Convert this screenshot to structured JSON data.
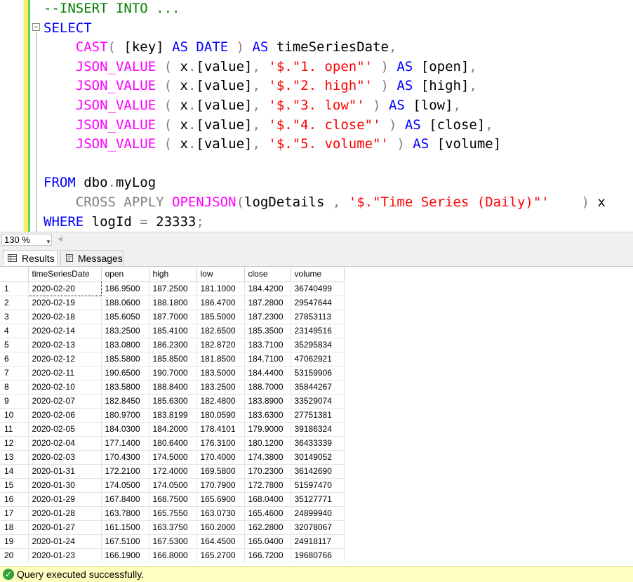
{
  "editor": {
    "lines": [
      [
        {
          "t": "--INSERT INTO ...",
          "c": "cm"
        }
      ],
      [
        {
          "t": "SELECT",
          "c": "kw"
        }
      ],
      [
        {
          "t": "    ",
          "c": "tx"
        },
        {
          "t": "CAST",
          "c": "fn"
        },
        {
          "t": "( ",
          "c": "op"
        },
        {
          "t": "[key] ",
          "c": "tx"
        },
        {
          "t": "AS ",
          "c": "kw"
        },
        {
          "t": "DATE ",
          "c": "kw"
        },
        {
          "t": ") ",
          "c": "op"
        },
        {
          "t": "AS ",
          "c": "kw"
        },
        {
          "t": "timeSeriesDate",
          "c": "tx"
        },
        {
          "t": ",",
          "c": "op"
        }
      ],
      [
        {
          "t": "    ",
          "c": "tx"
        },
        {
          "t": "JSON_VALUE ",
          "c": "fn"
        },
        {
          "t": "( ",
          "c": "op"
        },
        {
          "t": "x",
          "c": "tx"
        },
        {
          "t": ".",
          "c": "op"
        },
        {
          "t": "[value]",
          "c": "tx"
        },
        {
          "t": ", ",
          "c": "op"
        },
        {
          "t": "'$.\"1. open\"' ",
          "c": "str"
        },
        {
          "t": ") ",
          "c": "op"
        },
        {
          "t": "AS ",
          "c": "kw"
        },
        {
          "t": "[open]",
          "c": "tx"
        },
        {
          "t": ",",
          "c": "op"
        }
      ],
      [
        {
          "t": "    ",
          "c": "tx"
        },
        {
          "t": "JSON_VALUE ",
          "c": "fn"
        },
        {
          "t": "( ",
          "c": "op"
        },
        {
          "t": "x",
          "c": "tx"
        },
        {
          "t": ".",
          "c": "op"
        },
        {
          "t": "[value]",
          "c": "tx"
        },
        {
          "t": ", ",
          "c": "op"
        },
        {
          "t": "'$.\"2. high\"' ",
          "c": "str"
        },
        {
          "t": ") ",
          "c": "op"
        },
        {
          "t": "AS ",
          "c": "kw"
        },
        {
          "t": "[high]",
          "c": "tx"
        },
        {
          "t": ",",
          "c": "op"
        }
      ],
      [
        {
          "t": "    ",
          "c": "tx"
        },
        {
          "t": "JSON_VALUE ",
          "c": "fn"
        },
        {
          "t": "( ",
          "c": "op"
        },
        {
          "t": "x",
          "c": "tx"
        },
        {
          "t": ".",
          "c": "op"
        },
        {
          "t": "[value]",
          "c": "tx"
        },
        {
          "t": ", ",
          "c": "op"
        },
        {
          "t": "'$.\"3. low\"' ",
          "c": "str"
        },
        {
          "t": ") ",
          "c": "op"
        },
        {
          "t": "AS ",
          "c": "kw"
        },
        {
          "t": "[low]",
          "c": "tx"
        },
        {
          "t": ",",
          "c": "op"
        }
      ],
      [
        {
          "t": "    ",
          "c": "tx"
        },
        {
          "t": "JSON_VALUE ",
          "c": "fn"
        },
        {
          "t": "( ",
          "c": "op"
        },
        {
          "t": "x",
          "c": "tx"
        },
        {
          "t": ".",
          "c": "op"
        },
        {
          "t": "[value]",
          "c": "tx"
        },
        {
          "t": ", ",
          "c": "op"
        },
        {
          "t": "'$.\"4. close\"' ",
          "c": "str"
        },
        {
          "t": ") ",
          "c": "op"
        },
        {
          "t": "AS ",
          "c": "kw"
        },
        {
          "t": "[close]",
          "c": "tx"
        },
        {
          "t": ",",
          "c": "op"
        }
      ],
      [
        {
          "t": "    ",
          "c": "tx"
        },
        {
          "t": "JSON_VALUE ",
          "c": "fn"
        },
        {
          "t": "( ",
          "c": "op"
        },
        {
          "t": "x",
          "c": "tx"
        },
        {
          "t": ".",
          "c": "op"
        },
        {
          "t": "[value]",
          "c": "tx"
        },
        {
          "t": ", ",
          "c": "op"
        },
        {
          "t": "'$.\"5. volume\"' ",
          "c": "str"
        },
        {
          "t": ") ",
          "c": "op"
        },
        {
          "t": "AS ",
          "c": "kw"
        },
        {
          "t": "[volume]",
          "c": "tx"
        }
      ],
      [],
      [
        {
          "t": "FROM ",
          "c": "kw"
        },
        {
          "t": "dbo",
          "c": "tx"
        },
        {
          "t": ".",
          "c": "op"
        },
        {
          "t": "myLog",
          "c": "tx"
        }
      ],
      [
        {
          "t": "    ",
          "c": "tx"
        },
        {
          "t": "CROSS APPLY ",
          "c": "op"
        },
        {
          "t": "OPENJSON",
          "c": "fn"
        },
        {
          "t": "(",
          "c": "op"
        },
        {
          "t": "logDetails ",
          "c": "tx"
        },
        {
          "t": ", ",
          "c": "op"
        },
        {
          "t": "'$.\"Time Series (Daily)\"'  ",
          "c": "str"
        },
        {
          "t": "  ) ",
          "c": "op"
        },
        {
          "t": "x",
          "c": "tx"
        }
      ],
      [
        {
          "t": "WHERE ",
          "c": "kw"
        },
        {
          "t": "logId ",
          "c": "tx"
        },
        {
          "t": "= ",
          "c": "op"
        },
        {
          "t": "23333",
          "c": "tx"
        },
        {
          "t": ";",
          "c": "op"
        }
      ]
    ]
  },
  "zoom": {
    "value": "130 %"
  },
  "tabs": {
    "results": "Results",
    "messages": "Messages"
  },
  "grid": {
    "columns": [
      "",
      "timeSeriesDate",
      "open",
      "high",
      "low",
      "close",
      "volume"
    ],
    "rows": [
      [
        "1",
        "2020-02-20",
        "186.9500",
        "187.2500",
        "181.1000",
        "184.4200",
        "36740499"
      ],
      [
        "2",
        "2020-02-19",
        "188.0600",
        "188.1800",
        "186.4700",
        "187.2800",
        "29547644"
      ],
      [
        "3",
        "2020-02-18",
        "185.6050",
        "187.7000",
        "185.5000",
        "187.2300",
        "27853113"
      ],
      [
        "4",
        "2020-02-14",
        "183.2500",
        "185.4100",
        "182.6500",
        "185.3500",
        "23149516"
      ],
      [
        "5",
        "2020-02-13",
        "183.0800",
        "186.2300",
        "182.8720",
        "183.7100",
        "35295834"
      ],
      [
        "6",
        "2020-02-12",
        "185.5800",
        "185.8500",
        "181.8500",
        "184.7100",
        "47062921"
      ],
      [
        "7",
        "2020-02-11",
        "190.6500",
        "190.7000",
        "183.5000",
        "184.4400",
        "53159906"
      ],
      [
        "8",
        "2020-02-10",
        "183.5800",
        "188.8400",
        "183.2500",
        "188.7000",
        "35844267"
      ],
      [
        "9",
        "2020-02-07",
        "182.8450",
        "185.6300",
        "182.4800",
        "183.8900",
        "33529074"
      ],
      [
        "10",
        "2020-02-06",
        "180.9700",
        "183.8199",
        "180.0590",
        "183.6300",
        "27751381"
      ],
      [
        "11",
        "2020-02-05",
        "184.0300",
        "184.2000",
        "178.4101",
        "179.9000",
        "39186324"
      ],
      [
        "12",
        "2020-02-04",
        "177.1400",
        "180.6400",
        "176.3100",
        "180.1200",
        "36433339"
      ],
      [
        "13",
        "2020-02-03",
        "170.4300",
        "174.5000",
        "170.4000",
        "174.3800",
        "30149052"
      ],
      [
        "14",
        "2020-01-31",
        "172.2100",
        "172.4000",
        "169.5800",
        "170.2300",
        "36142690"
      ],
      [
        "15",
        "2020-01-30",
        "174.0500",
        "174.0500",
        "170.7900",
        "172.7800",
        "51597470"
      ],
      [
        "16",
        "2020-01-29",
        "167.8400",
        "168.7500",
        "165.6900",
        "168.0400",
        "35127771"
      ],
      [
        "17",
        "2020-01-28",
        "163.7800",
        "165.7550",
        "163.0730",
        "165.4600",
        "24899940"
      ],
      [
        "18",
        "2020-01-27",
        "161.1500",
        "163.3750",
        "160.2000",
        "162.2800",
        "32078067"
      ],
      [
        "19",
        "2020-01-24",
        "167.5100",
        "167.5300",
        "164.4500",
        "165.0400",
        "24918117"
      ],
      [
        "20",
        "2020-01-23",
        "166.1900",
        "166.8000",
        "165.2700",
        "166.7200",
        "19680766"
      ]
    ]
  },
  "status": {
    "text": "Query executed successfully.",
    "icon": "check-circle-icon",
    "color": "#ffffc0"
  }
}
